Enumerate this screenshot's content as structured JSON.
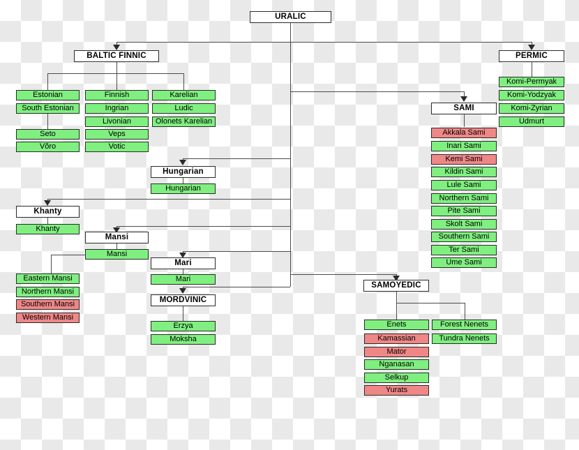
{
  "diagram": {
    "title": "URALIC",
    "legend": {
      "living_color": "#7ff07f",
      "extinct_color": "#f08787",
      "group_color": "#ffffff",
      "line_color": "#4b4b4b"
    },
    "root": {
      "label": "URALIC"
    },
    "groups": {
      "baltic_finnic": {
        "label": "BALTIC FINNIC"
      },
      "permic": {
        "label": "PERMIC"
      },
      "sami": {
        "label": "SAMI"
      },
      "hungarian": {
        "label": "Hungarian"
      },
      "khanty": {
        "label": "Khanty"
      },
      "mansi": {
        "label": "Mansi"
      },
      "mari": {
        "label": "Mari"
      },
      "mordvinic": {
        "label": "MORDVINIC"
      },
      "samoyedic": {
        "label": "SAMOYEDIC"
      }
    },
    "languages": {
      "baltic_finnic_col1": [
        {
          "label": "Estonian",
          "status": "living"
        },
        {
          "label": "South Estonian",
          "status": "living"
        },
        {
          "label": "Seto",
          "status": "living"
        },
        {
          "label": "Võro",
          "status": "living"
        }
      ],
      "baltic_finnic_col2": [
        {
          "label": "Finnish",
          "status": "living"
        },
        {
          "label": "Ingrian",
          "status": "living"
        },
        {
          "label": "Livonian",
          "status": "living"
        },
        {
          "label": "Veps",
          "status": "living"
        },
        {
          "label": "Votic",
          "status": "living"
        }
      ],
      "baltic_finnic_col3": [
        {
          "label": "Karelian",
          "status": "living"
        },
        {
          "label": "Ludic",
          "status": "living"
        },
        {
          "label": "Olonets Karelian",
          "status": "living"
        }
      ],
      "permic": [
        {
          "label": "Komi-Permyak",
          "status": "living"
        },
        {
          "label": "Komi-Yodzyak",
          "status": "living"
        },
        {
          "label": "Komi-Zyrian",
          "status": "living"
        },
        {
          "label": "Udmurt",
          "status": "living"
        }
      ],
      "sami": [
        {
          "label": "Akkala Sami",
          "status": "extinct"
        },
        {
          "label": "Inari Sami",
          "status": "living"
        },
        {
          "label": "Kemi Sami",
          "status": "extinct"
        },
        {
          "label": "Kildin Sami",
          "status": "living"
        },
        {
          "label": "Lule Sami",
          "status": "living"
        },
        {
          "label": "Northern Sami",
          "status": "living"
        },
        {
          "label": "Pite Sami",
          "status": "living"
        },
        {
          "label": "Skolt Sami",
          "status": "living"
        },
        {
          "label": "Southern Sami",
          "status": "living"
        },
        {
          "label": "Ter Sami",
          "status": "living"
        },
        {
          "label": "Ume Sami",
          "status": "living"
        }
      ],
      "hungarian": [
        {
          "label": "Hungarian",
          "status": "living"
        }
      ],
      "khanty": [
        {
          "label": "Khanty",
          "status": "living"
        }
      ],
      "mansi": [
        {
          "label": "Mansi",
          "status": "living"
        }
      ],
      "mansi_varieties": [
        {
          "label": "Eastern Mansi",
          "status": "living"
        },
        {
          "label": "Northern Mansi",
          "status": "living"
        },
        {
          "label": "Southern Mansi",
          "status": "extinct"
        },
        {
          "label": "Western Mansi",
          "status": "extinct"
        }
      ],
      "mari": [
        {
          "label": "Mari",
          "status": "living"
        }
      ],
      "mordvinic": [
        {
          "label": "Erzya",
          "status": "living"
        },
        {
          "label": "Moksha",
          "status": "living"
        }
      ],
      "samoyedic_col1": [
        {
          "label": "Enets",
          "status": "living"
        },
        {
          "label": "Kamassian",
          "status": "extinct"
        },
        {
          "label": "Mator",
          "status": "extinct"
        },
        {
          "label": "Nganasan",
          "status": "living"
        },
        {
          "label": "Selkup",
          "status": "living"
        },
        {
          "label": "Yurats",
          "status": "extinct"
        }
      ],
      "samoyedic_col2": [
        {
          "label": "Forest Nenets",
          "status": "living"
        },
        {
          "label": "Tundra Nenets",
          "status": "living"
        }
      ]
    }
  }
}
